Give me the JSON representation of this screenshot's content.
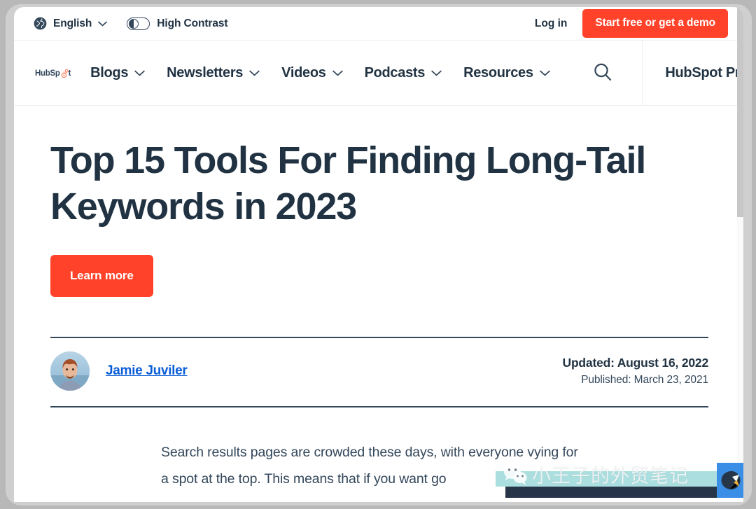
{
  "utility_bar": {
    "globe_icon": "globe-icon",
    "language": "English",
    "language_chevron": "chevron-down-icon",
    "contrast_toggle_icon": "contrast-toggle-icon",
    "contrast_label": "High Contrast",
    "login_label": "Log in",
    "cta_label": "Start free or get a demo"
  },
  "nav": {
    "logo_pre": "HubSp",
    "logo_post": "t",
    "items": [
      {
        "label": "Blogs",
        "chevron": "chevron-down-icon"
      },
      {
        "label": "Newsletters",
        "chevron": "chevron-down-icon"
      },
      {
        "label": "Videos",
        "chevron": "chevron-down-icon"
      },
      {
        "label": "Podcasts",
        "chevron": "chevron-down-icon"
      },
      {
        "label": "Resources",
        "chevron": "chevron-down-icon"
      }
    ],
    "search_icon": "search-icon",
    "right_label": "HubSpot Product"
  },
  "article": {
    "title": "Top 15 Tools For Finding Long-Tail Keywords in 2023",
    "learn_more_label": "Learn more",
    "author": "Jamie Juviler",
    "updated": "Updated: August 16, 2022",
    "published": "Published: March 23, 2021",
    "body": "Search results pages are crowded these days, with everyone vying for a spot at the top. This means that if you want go"
  },
  "watermark": {
    "chat_icon": "wechat-bubble-icon",
    "text": "小王子的外贸笔记",
    "badge_icon": "logo-badge-icon"
  },
  "colors": {
    "accent_orange": "#ff4229",
    "navy": "#213343",
    "slate": "#33475b",
    "link_blue": "#0b5ed7",
    "watermark_teal": "#abdfdf",
    "watermark_navy": "#263548",
    "badge_blue": "#3a8ee6"
  }
}
